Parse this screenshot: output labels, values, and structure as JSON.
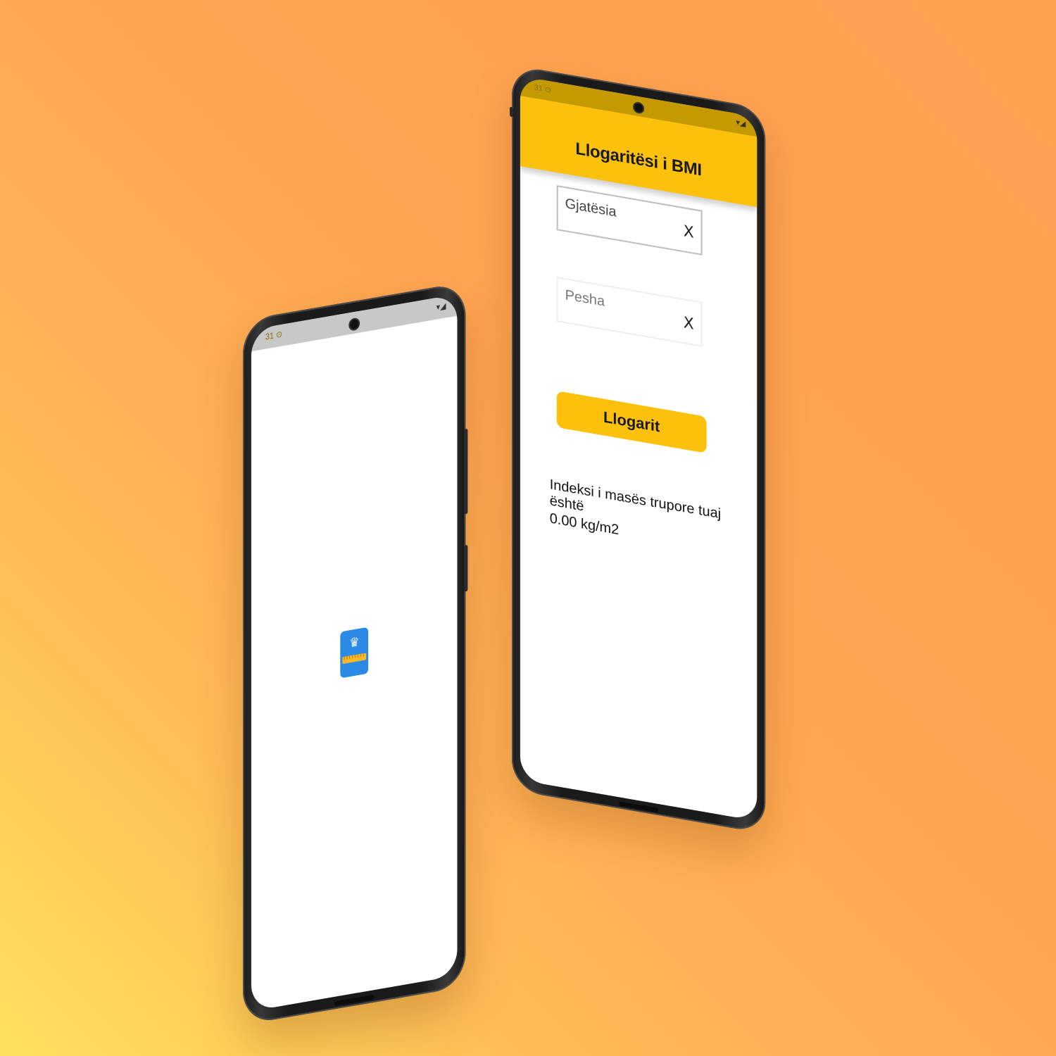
{
  "splash_phone": {
    "status_left": "31 ⊙",
    "status_right": "▾◢",
    "app_icon": "bmi-app-icon"
  },
  "app_phone": {
    "status_left": "31 ⊙",
    "status_right": "▾◢",
    "title": "Llogaritësi i BMI",
    "height_field": {
      "placeholder": "Gjatësia",
      "value": ""
    },
    "weight_field": {
      "placeholder": "Pesha",
      "value": ""
    },
    "clear_symbol": "X",
    "calculate_button": "Llogarit",
    "result_label": "Indeksi i masës trupore tuaj është",
    "result_value": "0.00 kg/m2"
  },
  "colors": {
    "accent": "#fcc10d",
    "background_start": "#ffe15e",
    "background_end": "#ffa04f"
  }
}
